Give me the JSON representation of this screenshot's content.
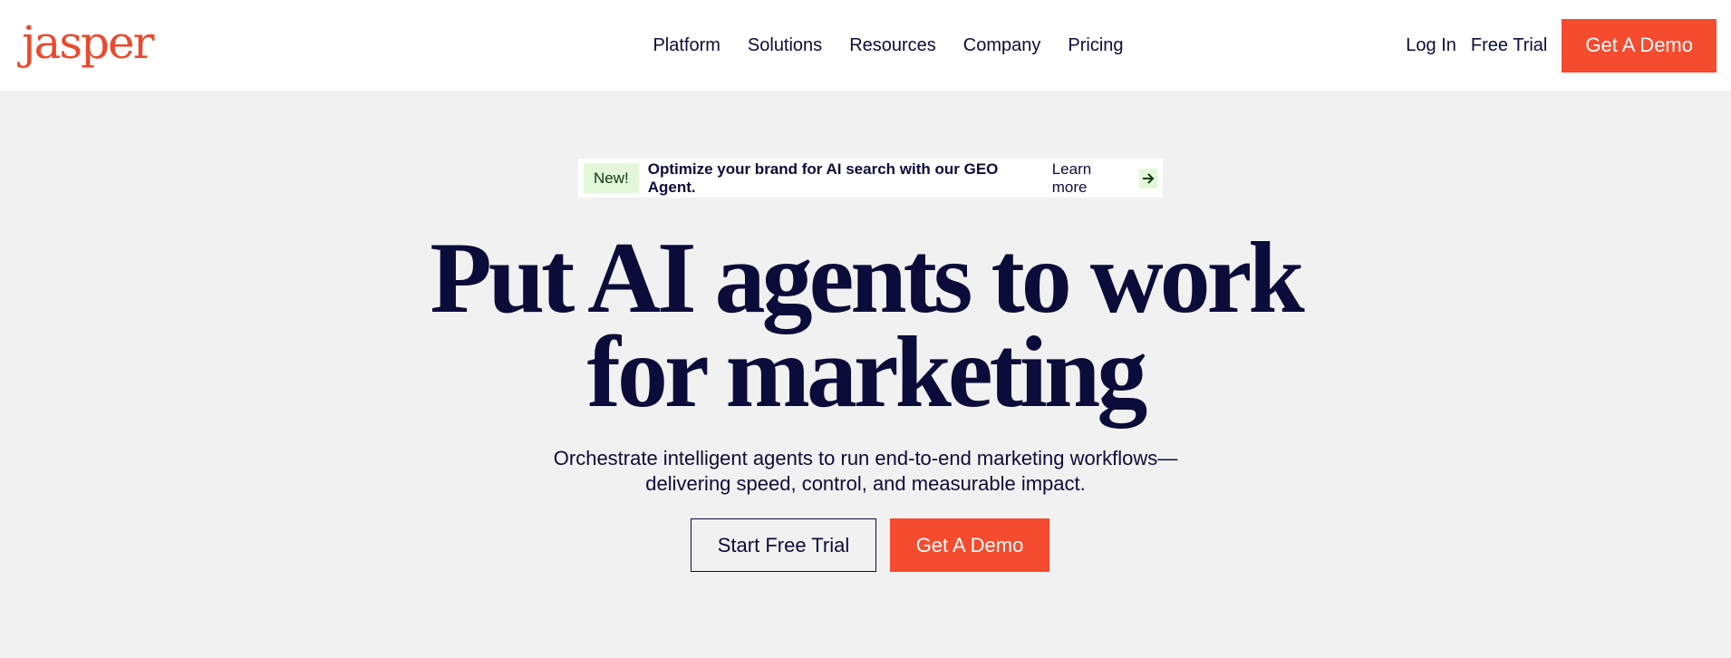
{
  "header": {
    "logo": "jasper",
    "nav": [
      "Platform",
      "Solutions",
      "Resources",
      "Company",
      "Pricing"
    ],
    "login": "Log In",
    "free_trial": "Free Trial",
    "demo": "Get A Demo"
  },
  "announcement": {
    "badge": "New!",
    "text": "Optimize your brand for AI search with our GEO Agent.",
    "link": "Learn more",
    "icon": "arrow-right-icon"
  },
  "hero": {
    "line1": "Put AI agents to work",
    "line2": "for marketing",
    "subtitle_line1": "Orchestrate intelligent agents to run end-to-end marketing workflows—",
    "subtitle_line2": "delivering speed, control, and measurable impact.",
    "cta_primary": "Start Free Trial",
    "cta_secondary": "Get A Demo"
  },
  "colors": {
    "brand": "#f54b2e",
    "text": "#0c0c3a",
    "background": "#f1f1f1",
    "badge": "#e2f8d8"
  }
}
